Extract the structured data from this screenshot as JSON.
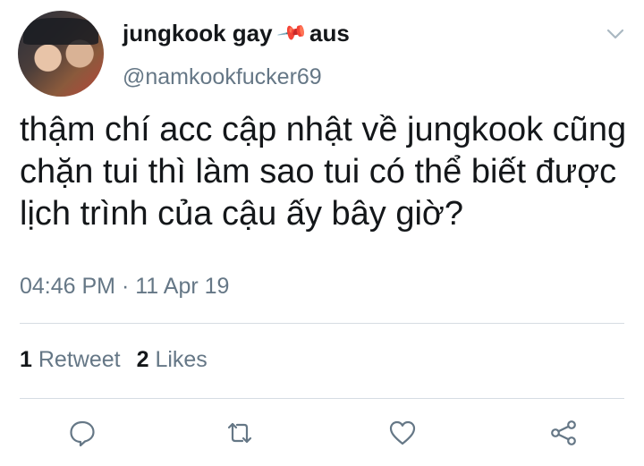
{
  "author": {
    "display_name": "jungkook gay",
    "pin_emoji": "📌",
    "display_suffix": "aus",
    "handle": "@namkookfucker69"
  },
  "tweet": {
    "text": "thậm chí acc cập nhật về jungkook cũng chặn tui thì làm sao tui có thể biết được lịch trình của cậu ấy bây giờ?",
    "time": "04:46 PM",
    "separator": "·",
    "date": "11 Apr 19"
  },
  "stats": {
    "retweets_count": "1",
    "retweets_label": "Retweet",
    "likes_count": "2",
    "likes_label": "Likes"
  },
  "actions": {
    "reply_icon": "reply-icon",
    "retweet_icon": "retweet-icon",
    "like_icon": "heart-icon",
    "share_icon": "share-icon"
  },
  "colors": {
    "text_primary": "#14171a",
    "text_secondary": "#657786",
    "divider": "#d6dde3"
  }
}
